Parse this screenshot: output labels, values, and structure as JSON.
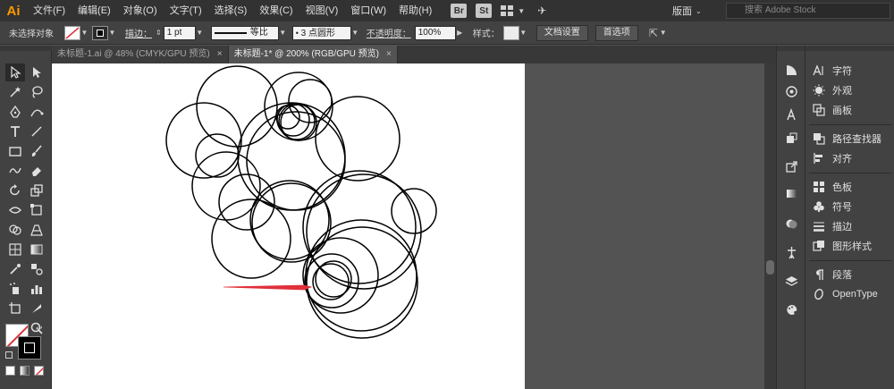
{
  "app": {
    "logo": "Ai"
  },
  "menu": [
    "文件(F)",
    "编辑(E)",
    "对象(O)",
    "文字(T)",
    "选择(S)",
    "效果(C)",
    "视图(V)",
    "窗口(W)",
    "帮助(H)"
  ],
  "menubar_icons": {
    "bridge": "Br",
    "stock": "St"
  },
  "workspace": {
    "label": "版面"
  },
  "search": {
    "placeholder": "搜索 Adobe Stock"
  },
  "control": {
    "selection": "未选择对象",
    "stroke_label": "描边：",
    "stroke_value": "1 pt",
    "profile": "等比",
    "brush": "3 点圆形",
    "opacity_label": "不透明度：",
    "opacity_value": "100%",
    "style_label": "样式：",
    "doc_setup": "文档设置",
    "preferences": "首选项"
  },
  "tabs": [
    {
      "label": "未标题-1.ai @ 48% (CMYK/GPU 预览)",
      "close": "×"
    },
    {
      "label": "未标题-1* @ 200% (RGB/GPU 预览)",
      "close": "×"
    }
  ],
  "panels": [
    {
      "label": "字符",
      "icon": "character-icon"
    },
    {
      "label": "外观",
      "icon": "appearance-icon"
    },
    {
      "label": "画板",
      "icon": "artboards-icon"
    },
    {
      "label": "路径查找器",
      "icon": "pathfinder-icon"
    },
    {
      "label": "对齐",
      "icon": "align-icon"
    },
    {
      "label": "色板",
      "icon": "swatches-icon"
    },
    {
      "label": "符号",
      "icon": "symbols-icon"
    },
    {
      "label": "描边",
      "icon": "stroke-icon"
    },
    {
      "label": "图形样式",
      "icon": "graphic-styles-icon"
    },
    {
      "label": "段落",
      "icon": "paragraph-icon"
    },
    {
      "label": "OpenType",
      "icon": "opentype-icon"
    }
  ],
  "colors": {
    "accent": "#ff9a00",
    "arrow": "#e0303a",
    "stroke": "#000000"
  }
}
